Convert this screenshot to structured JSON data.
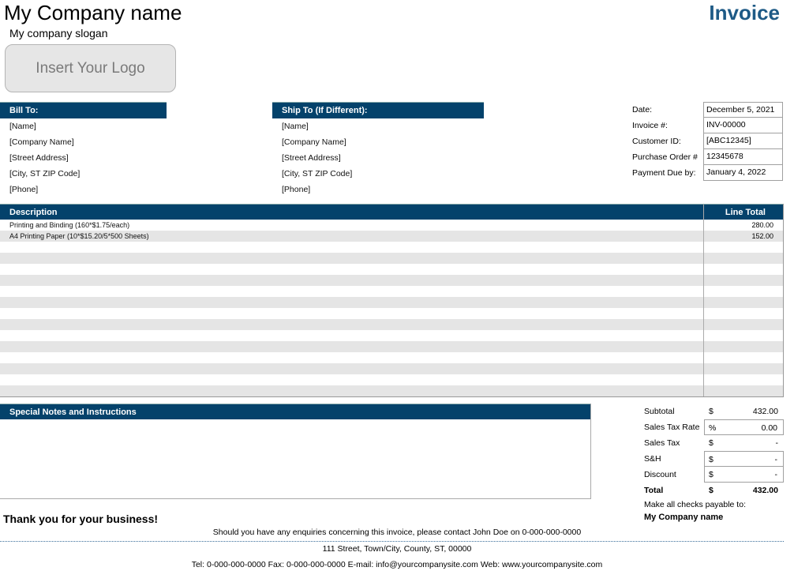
{
  "header": {
    "company_name": "My Company name",
    "slogan": "My company slogan",
    "logo_placeholder": "Insert Your Logo",
    "title": "Invoice",
    "accent_color": "#04426b",
    "title_color": "#1e5a86"
  },
  "bill_to": {
    "heading": "Bill To:",
    "lines": [
      "[Name]",
      "[Company Name]",
      "[Street Address]",
      "[City, ST  ZIP Code]",
      "[Phone]"
    ]
  },
  "ship_to": {
    "heading": "Ship To (If Different):",
    "lines": [
      "[Name]",
      "[Company Name]",
      "[Street Address]",
      "[City, ST  ZIP Code]",
      "[Phone]"
    ]
  },
  "meta": [
    {
      "label": "Date:",
      "value": "December 5, 2021"
    },
    {
      "label": "Invoice #:",
      "value": "INV-00000"
    },
    {
      "label": "Customer ID:",
      "value": "[ABC12345]"
    },
    {
      "label": "Purchase Order #",
      "value": "12345678"
    },
    {
      "label": "Payment Due by:",
      "value": "January 4, 2022"
    }
  ],
  "items": {
    "headers": {
      "description": "Description",
      "line_total": "Line Total"
    },
    "rows": [
      {
        "description": "Printing and Binding (160*$1.75/each)",
        "line_total": "280.00"
      },
      {
        "description": "A4 Printing Paper (10*$15.20/5*500 Sheets)",
        "line_total": "152.00"
      },
      {
        "description": "",
        "line_total": ""
      },
      {
        "description": "",
        "line_total": ""
      },
      {
        "description": "",
        "line_total": ""
      },
      {
        "description": "",
        "line_total": ""
      },
      {
        "description": "",
        "line_total": ""
      },
      {
        "description": "",
        "line_total": ""
      },
      {
        "description": "",
        "line_total": ""
      },
      {
        "description": "",
        "line_total": ""
      },
      {
        "description": "",
        "line_total": ""
      },
      {
        "description": "",
        "line_total": ""
      },
      {
        "description": "",
        "line_total": ""
      },
      {
        "description": "",
        "line_total": ""
      },
      {
        "description": "",
        "line_total": ""
      },
      {
        "description": "",
        "line_total": ""
      }
    ]
  },
  "notes": {
    "heading": "Special Notes and Instructions",
    "content": ""
  },
  "totals": {
    "subtotal": {
      "label": "Subtotal",
      "symbol": "$",
      "value": "432.00"
    },
    "tax_rate": {
      "label": "Sales Tax Rate",
      "symbol": "%",
      "value": "0.00"
    },
    "sales_tax": {
      "label": "Sales Tax",
      "symbol": "$",
      "value": "-"
    },
    "shipping": {
      "label": "S&H",
      "symbol": "$",
      "value": "-"
    },
    "discount": {
      "label": "Discount",
      "symbol": "$",
      "value": "-"
    },
    "total": {
      "label": "Total",
      "symbol": "$",
      "value": "432.00"
    },
    "checks_label": "Make all checks payable to:",
    "checks_name": "My Company name"
  },
  "footer": {
    "thanks": "Thank you for your business!",
    "enquiries": "Should you have any enquiries concerning this invoice, please contact John Doe on 0-000-000-0000",
    "address": "111 Street, Town/City, County, ST, 00000",
    "contact": "Tel: 0-000-000-0000 Fax: 0-000-000-0000 E-mail: info@yourcompanysite.com Web: www.yourcompanysite.com"
  }
}
